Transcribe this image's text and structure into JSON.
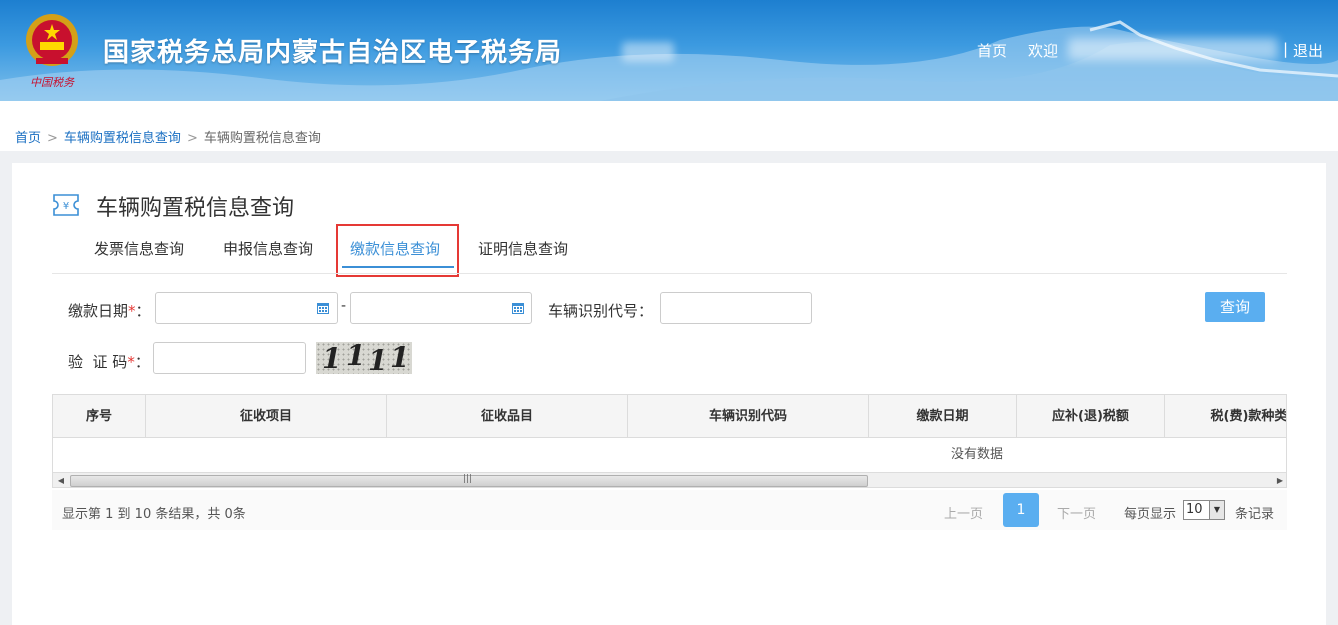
{
  "header": {
    "title": "国家税务总局内蒙古自治区电子税务局",
    "home_link": "首页",
    "welcome": "欢迎",
    "separator": "|",
    "logout": "退出"
  },
  "breadcrumb": {
    "items": [
      "首页",
      "车辆购置税信息查询",
      "车辆购置税信息查询"
    ],
    "separator": ">"
  },
  "page": {
    "title": "车辆购置税信息查询"
  },
  "tabs": [
    {
      "label": "发票信息查询",
      "active": false
    },
    {
      "label": "申报信息查询",
      "active": false
    },
    {
      "label": "缴款信息查询",
      "active": true
    },
    {
      "label": "证明信息查询",
      "active": false
    }
  ],
  "form": {
    "payment_date_label": "缴款日期",
    "required_mark": "*",
    "colon": "：",
    "date_start_value": "",
    "date_end_value": "",
    "date_separator": "-",
    "vin_label": "车辆识别代号",
    "vin_value": "",
    "captcha_label": "验  证 码",
    "captcha_value": "",
    "captcha_image_text": [
      "1",
      "1",
      "1",
      "1"
    ],
    "query_button": "查询"
  },
  "table": {
    "columns": [
      "序号",
      "征收项目",
      "征收品目",
      "车辆识别代码",
      "缴款日期",
      "应补(退)税额",
      "税(费)款种类"
    ],
    "empty_text": "没有数据"
  },
  "pagination": {
    "summary": "显示第 1 到 10 条结果，共 0条",
    "prev": "上一页",
    "current_page": "1",
    "next": "下一页",
    "per_page_label": "每页显示",
    "per_page_value": "10",
    "records_label": "条记录"
  },
  "colors": {
    "accent": "#3b8fd6",
    "button": "#5aaef0",
    "highlight_border": "#e53935",
    "header_top": "#1d7fd0"
  },
  "icons": [
    "national-emblem-icon",
    "tax-ticket-icon",
    "calendar-icon",
    "scroll-left-arrow-icon",
    "scroll-right-arrow-icon",
    "dropdown-arrow-icon"
  ]
}
